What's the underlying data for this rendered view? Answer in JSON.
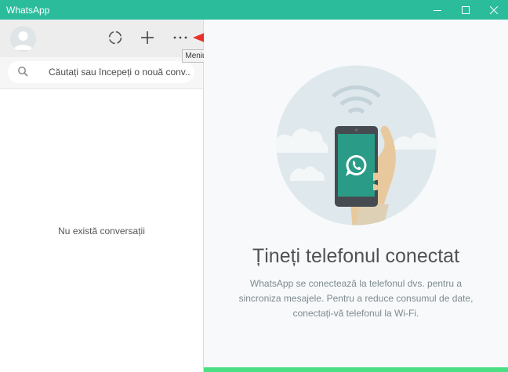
{
  "window": {
    "title": "WhatsApp"
  },
  "sidebar": {
    "search": {
      "placeholder": "Căutați sau începeți o nouă conv..."
    },
    "empty_text": "Nu există conversații",
    "menu_tooltip": "Meniu"
  },
  "main": {
    "heading": "Țineți telefonul conectat",
    "description": "WhatsApp se conectează la telefonul dvs. pentru a sincroniza mesajele. Pentru a reduce consumul de date, conectați-vă telefonul la Wi-Fi.",
    "progress": 1.0
  },
  "icons": {
    "avatar": "person-avatar-icon",
    "status": "status-ring-icon",
    "new_chat": "plus-icon",
    "menu": "more-dots-icon",
    "search": "search-icon",
    "annotation": "red-arrow-icon"
  },
  "colors": {
    "titlebar": "#2bbc9c",
    "accent": "#4adf83",
    "annotation_arrow": "#e8312a"
  }
}
